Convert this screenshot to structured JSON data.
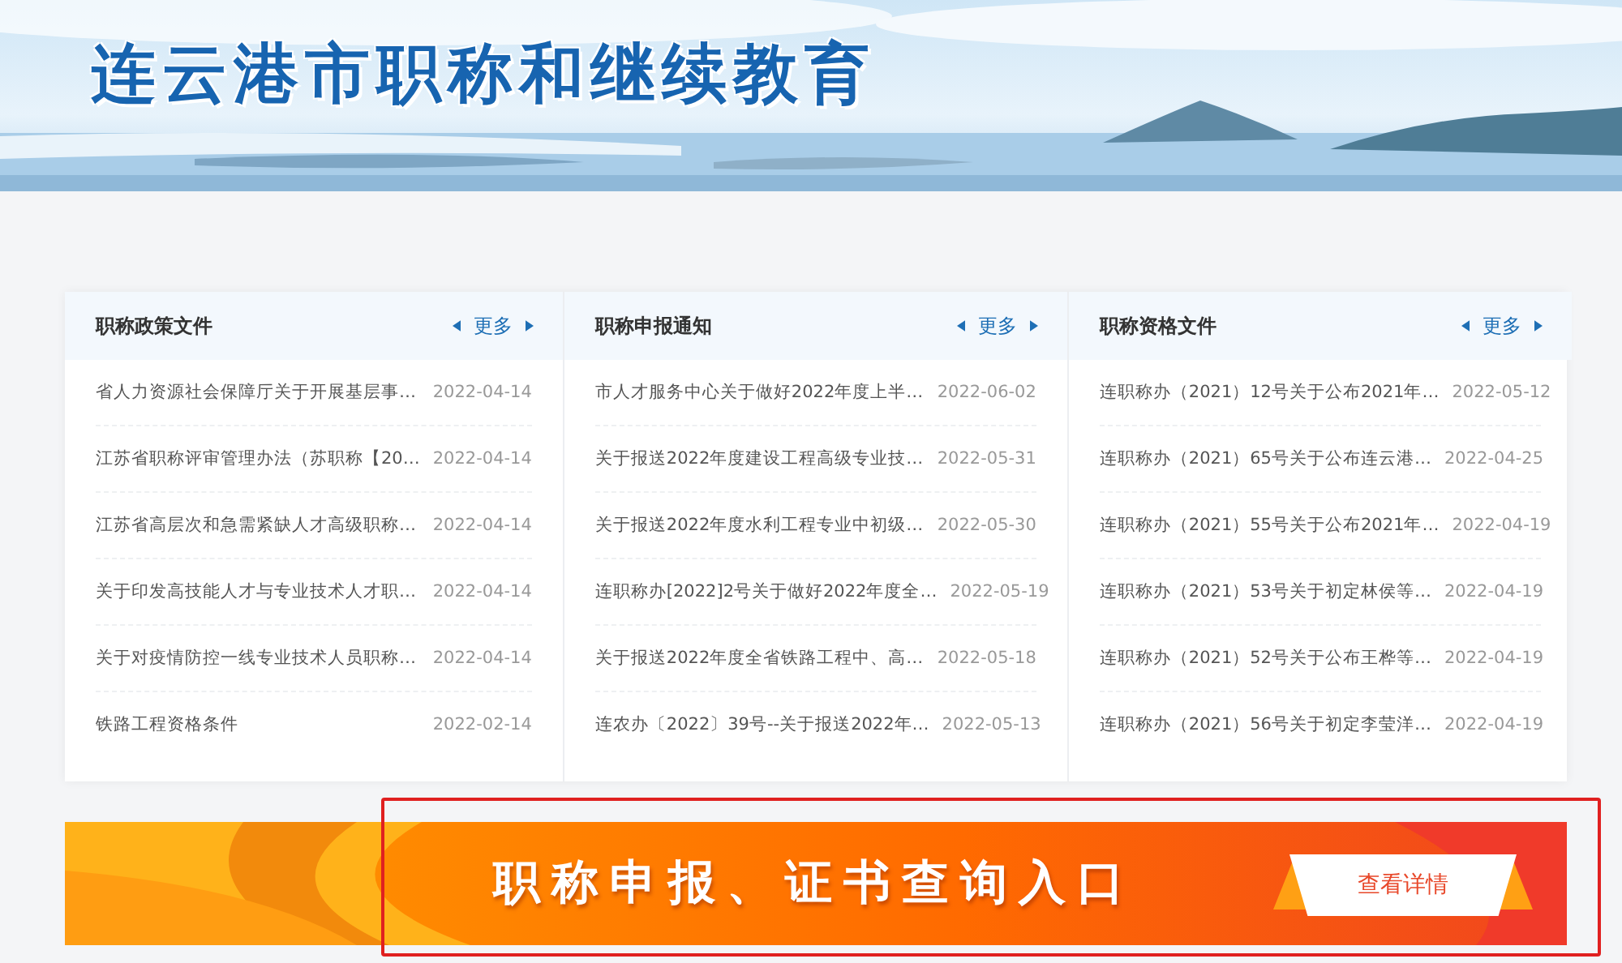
{
  "header": {
    "title": "连云港市职称和继续教育",
    "kind": "picture"
  },
  "columns": [
    {
      "title": "职称政策文件",
      "more": "更多",
      "items": [
        {
          "text": "省人力资源社会保障厅关于开展基层事…",
          "date": "2022-04-14"
        },
        {
          "text": "江苏省职称评审管理办法（苏职称【20…",
          "date": "2022-04-14"
        },
        {
          "text": "江苏省高层次和急需紧缺人才高级职称…",
          "date": "2022-04-14"
        },
        {
          "text": "关于印发高技能人才与专业技术人才职…",
          "date": "2022-04-14"
        },
        {
          "text": "关于对疫情防控一线专业技术人员职称…",
          "date": "2022-04-14"
        },
        {
          "text": "铁路工程资格条件",
          "date": "2022-02-14"
        }
      ]
    },
    {
      "title": "职称申报通知",
      "more": "更多",
      "items": [
        {
          "text": "市人才服务中心关于做好2022年度上半…",
          "date": "2022-06-02"
        },
        {
          "text": "关于报送2022年度建设工程高级专业技…",
          "date": "2022-05-31"
        },
        {
          "text": "关于报送2022年度水利工程专业中初级…",
          "date": "2022-05-30"
        },
        {
          "text": "连职称办[2022]2号关于做好2022年度全…",
          "date": "2022-05-19"
        },
        {
          "text": "关于报送2022年度全省铁路工程中、高…",
          "date": "2022-05-18"
        },
        {
          "text": "连农办〔2022〕39号--关于报送2022年…",
          "date": "2022-05-13"
        }
      ]
    },
    {
      "title": "职称资格文件",
      "more": "更多",
      "items": [
        {
          "text": "连职称办（2021）12号关于公布2021年…",
          "date": "2022-05-12"
        },
        {
          "text": "连职称办（2021）65号关于公布连云港…",
          "date": "2022-04-25"
        },
        {
          "text": "连职称办（2021）55号关于公布2021年…",
          "date": "2022-04-19"
        },
        {
          "text": "连职称办（2021）53号关于初定林侯等…",
          "date": "2022-04-19"
        },
        {
          "text": "连职称办（2021）52号关于公布王桦等…",
          "date": "2022-04-19"
        },
        {
          "text": "连职称办（2021）56号关于初定李莹洋…",
          "date": "2022-04-19"
        }
      ]
    }
  ],
  "promo": {
    "title": "职称申报、证书查询入口",
    "button": "查看详情",
    "highlighted": true
  }
}
